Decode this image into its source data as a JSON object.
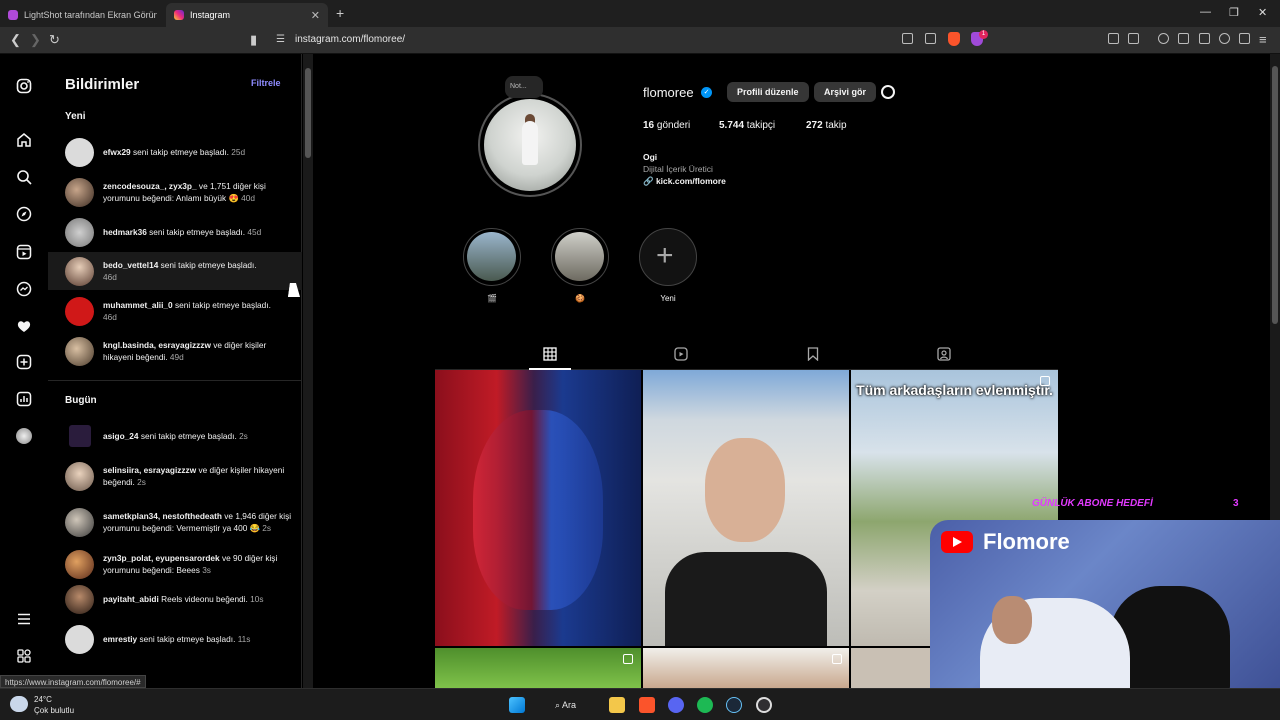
{
  "browser": {
    "tabs": [
      {
        "label": "LightShot tarafından Ekran Görüntüsü"
      },
      {
        "label": "Instagram"
      }
    ],
    "url": "instagram.com/flomoree/",
    "status_url": "https://www.instagram.com/flomoree/#",
    "extension_badge": "1"
  },
  "notifications": {
    "title": "Bildirimler",
    "filter": "Filtrele",
    "sections": [
      {
        "label": "Yeni",
        "items": [
          {
            "user": "efwx29",
            "text": " seni takip etmeye başladı.",
            "time": "25d"
          },
          {
            "user": "zencodesouza_, zyx3p_",
            "text": " ve 1,751 diğer kişi yorumunu beğendi: Anlamı büyük 😍",
            "time": "40d"
          },
          {
            "user": "hedmark36",
            "text": " seni takip etmeye başladı.",
            "time": "45d"
          },
          {
            "user": "bedo_vettel14",
            "text": " seni takip etmeye başladı.",
            "time": "46d"
          },
          {
            "user": "muhammet_alii_0",
            "text": " seni takip etmeye başladı.",
            "time": "46d"
          },
          {
            "user": "kngl.basinda, esrayagizzzw",
            "text": " ve diğer kişiler hikayeni beğendi.",
            "time": "49d"
          }
        ]
      },
      {
        "label": "Bugün",
        "items": [
          {
            "user": "asigo_24",
            "text": " seni takip etmeye başladı.",
            "time": "2s"
          },
          {
            "user": "selinsiira, esrayagizzzw",
            "text": " ve diğer kişiler hikayeni beğendi.",
            "time": "2s"
          },
          {
            "user": "sametkplan34, nestofthedeath",
            "text": " ve 1,946 diğer kişi yorumunu beğendi: Vermemiştir ya 400 😂",
            "time": "2s"
          },
          {
            "user": "zyn3p_polat, eyupensarordek",
            "text": " ve 90 diğer kişi yorumunu beğendi: Beees",
            "time": "3s"
          },
          {
            "user": "payitaht_abidi",
            "text": " Reels videonu beğendi.",
            "time": "10s"
          },
          {
            "user": "emrestiy",
            "text": " seni takip etmeye başladı.",
            "time": "11s"
          }
        ]
      }
    ]
  },
  "profile": {
    "note": "Not...",
    "username": "flomoree",
    "edit_button": "Profili düzenle",
    "archive_button": "Arşivi gör",
    "posts_count": "16",
    "posts_label": " gönderi",
    "followers_count": "5.744",
    "followers_label": " takipçi",
    "following_count": "272",
    "following_label": " takip",
    "name": "Ogi",
    "category": "Dijital İçerik Üretici",
    "link": "kick.com/flomore",
    "highlights": [
      {
        "label": "🎬"
      },
      {
        "label": "🍪"
      },
      {
        "label": "Yeni"
      }
    ],
    "post_caption_3": "Tüm arkadaşların evlenmiştir."
  },
  "overlay": {
    "goal_text": "GÜNLÜK ABONE HEDEFİ",
    "goal_count": "3",
    "channel": "Flomore"
  },
  "taskbar": {
    "temp": "24°C",
    "weather": "Çok bulutlu",
    "search": "Ara"
  },
  "colors": {
    "accent_filter": "#8f8cff",
    "verified": "#0095f6",
    "overlay_text": "#e23aff",
    "youtube": "#ff0000"
  }
}
